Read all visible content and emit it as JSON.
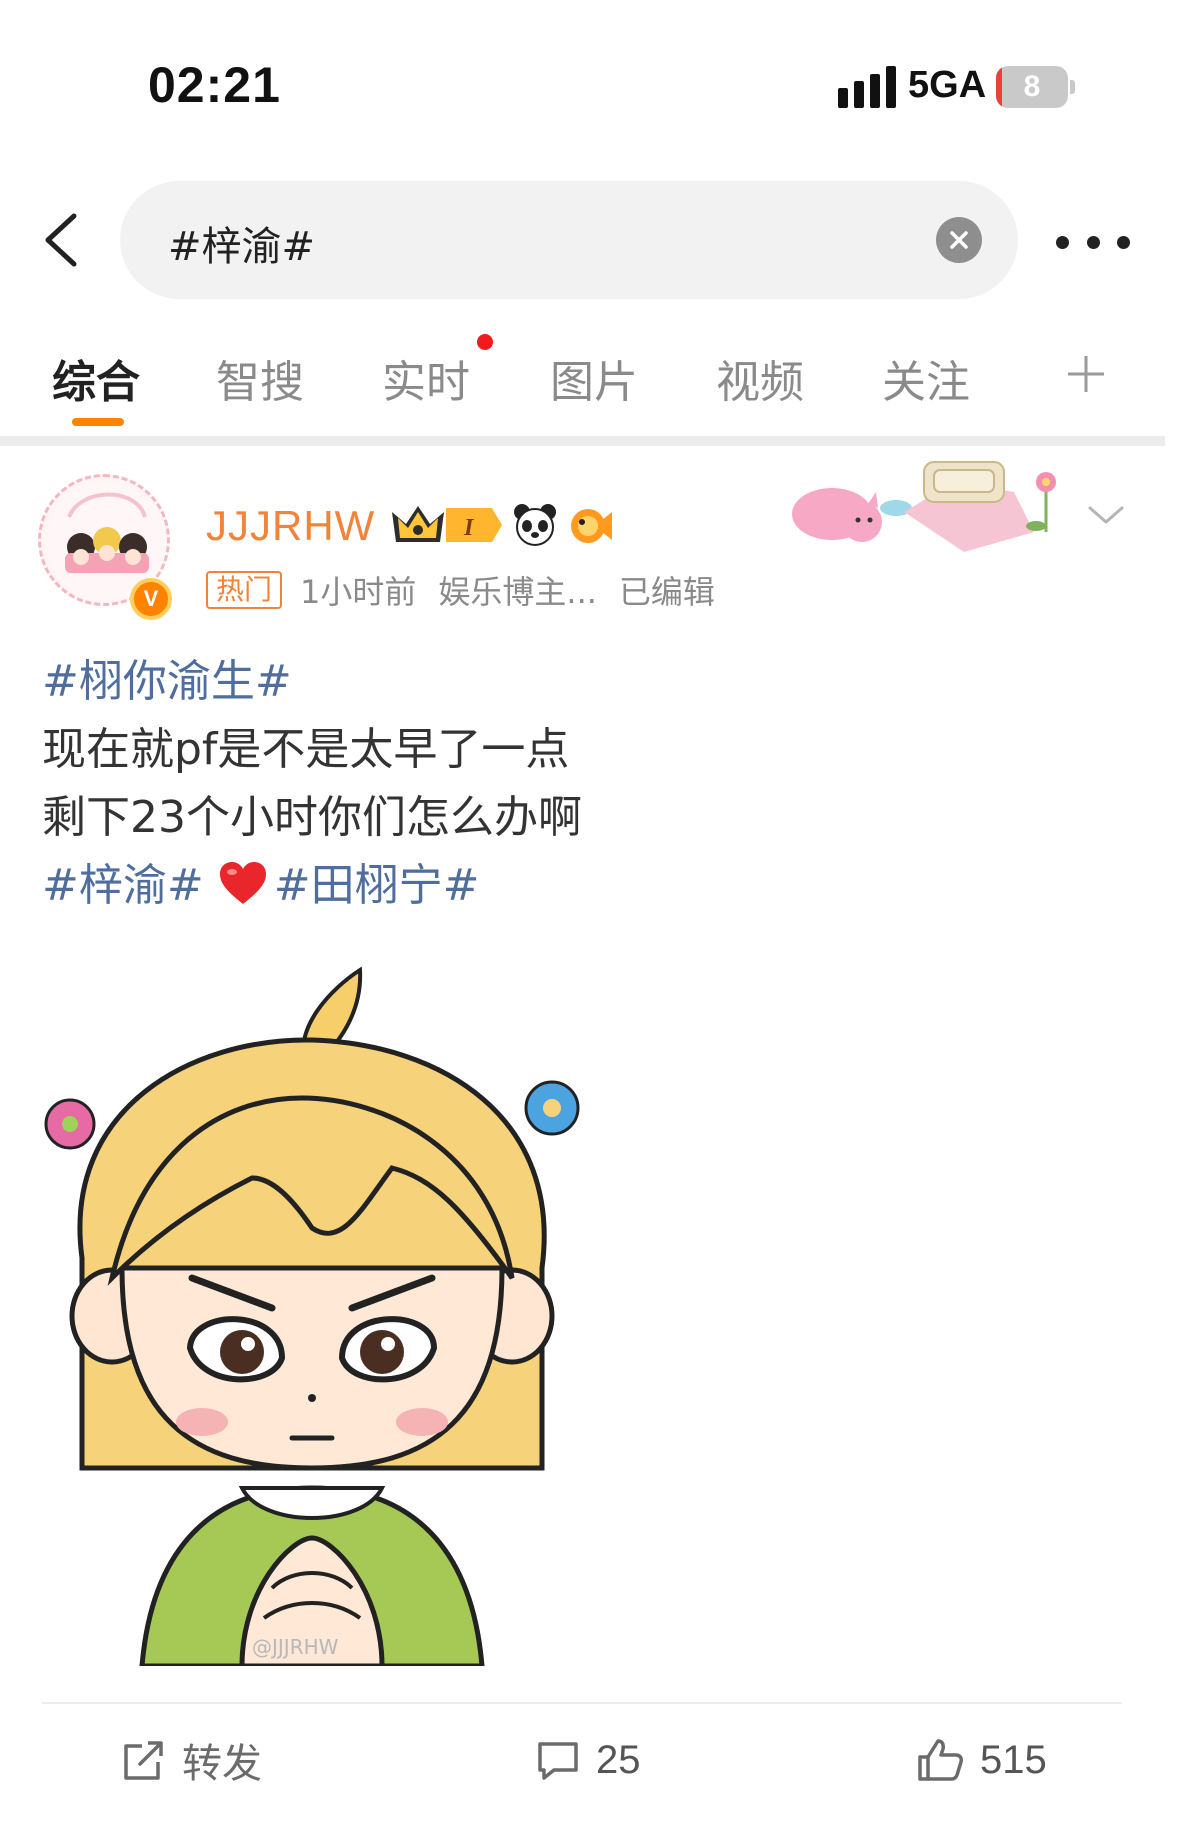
{
  "status_bar": {
    "time": "02:21",
    "network": "5GA",
    "battery": "8",
    "battery_level": 0.08,
    "battery_color": "#e8413c"
  },
  "search": {
    "query": "#梓渝#"
  },
  "tabs": [
    {
      "label": "综合",
      "active": true
    },
    {
      "label": "智搜",
      "active": false
    },
    {
      "label": "实时",
      "active": false,
      "badge_dot": true
    },
    {
      "label": "图片",
      "active": false
    },
    {
      "label": "视频",
      "active": false
    },
    {
      "label": "关注",
      "active": false
    }
  ],
  "accent_color": "#ff8200",
  "post": {
    "username": "JJJRHW",
    "hot_tag": "热门",
    "time": "1小时前",
    "category": "娱乐博主...",
    "edited": "已编辑",
    "lines": {
      "topic1": "#栩你渝生#",
      "line2": "现在就pf是不是太早了一点",
      "line3": "剩下23个小时你们怎么办啊",
      "topic2": "#梓渝#",
      "topic3": "#田栩宁#"
    },
    "image_watermark": "@JJJRHW"
  },
  "actions": {
    "repost_label": "转发",
    "comment_count": "25",
    "like_count": "515"
  },
  "icons": [
    "back-arrow-icon",
    "clear-icon",
    "more-icon",
    "add-tab-icon",
    "verified-icon",
    "crown-badge-icon",
    "panda-icon",
    "fish-icon",
    "chevron-down-icon",
    "heart-icon",
    "repost-icon",
    "comment-icon",
    "like-icon",
    "signal-icon",
    "battery-icon"
  ]
}
